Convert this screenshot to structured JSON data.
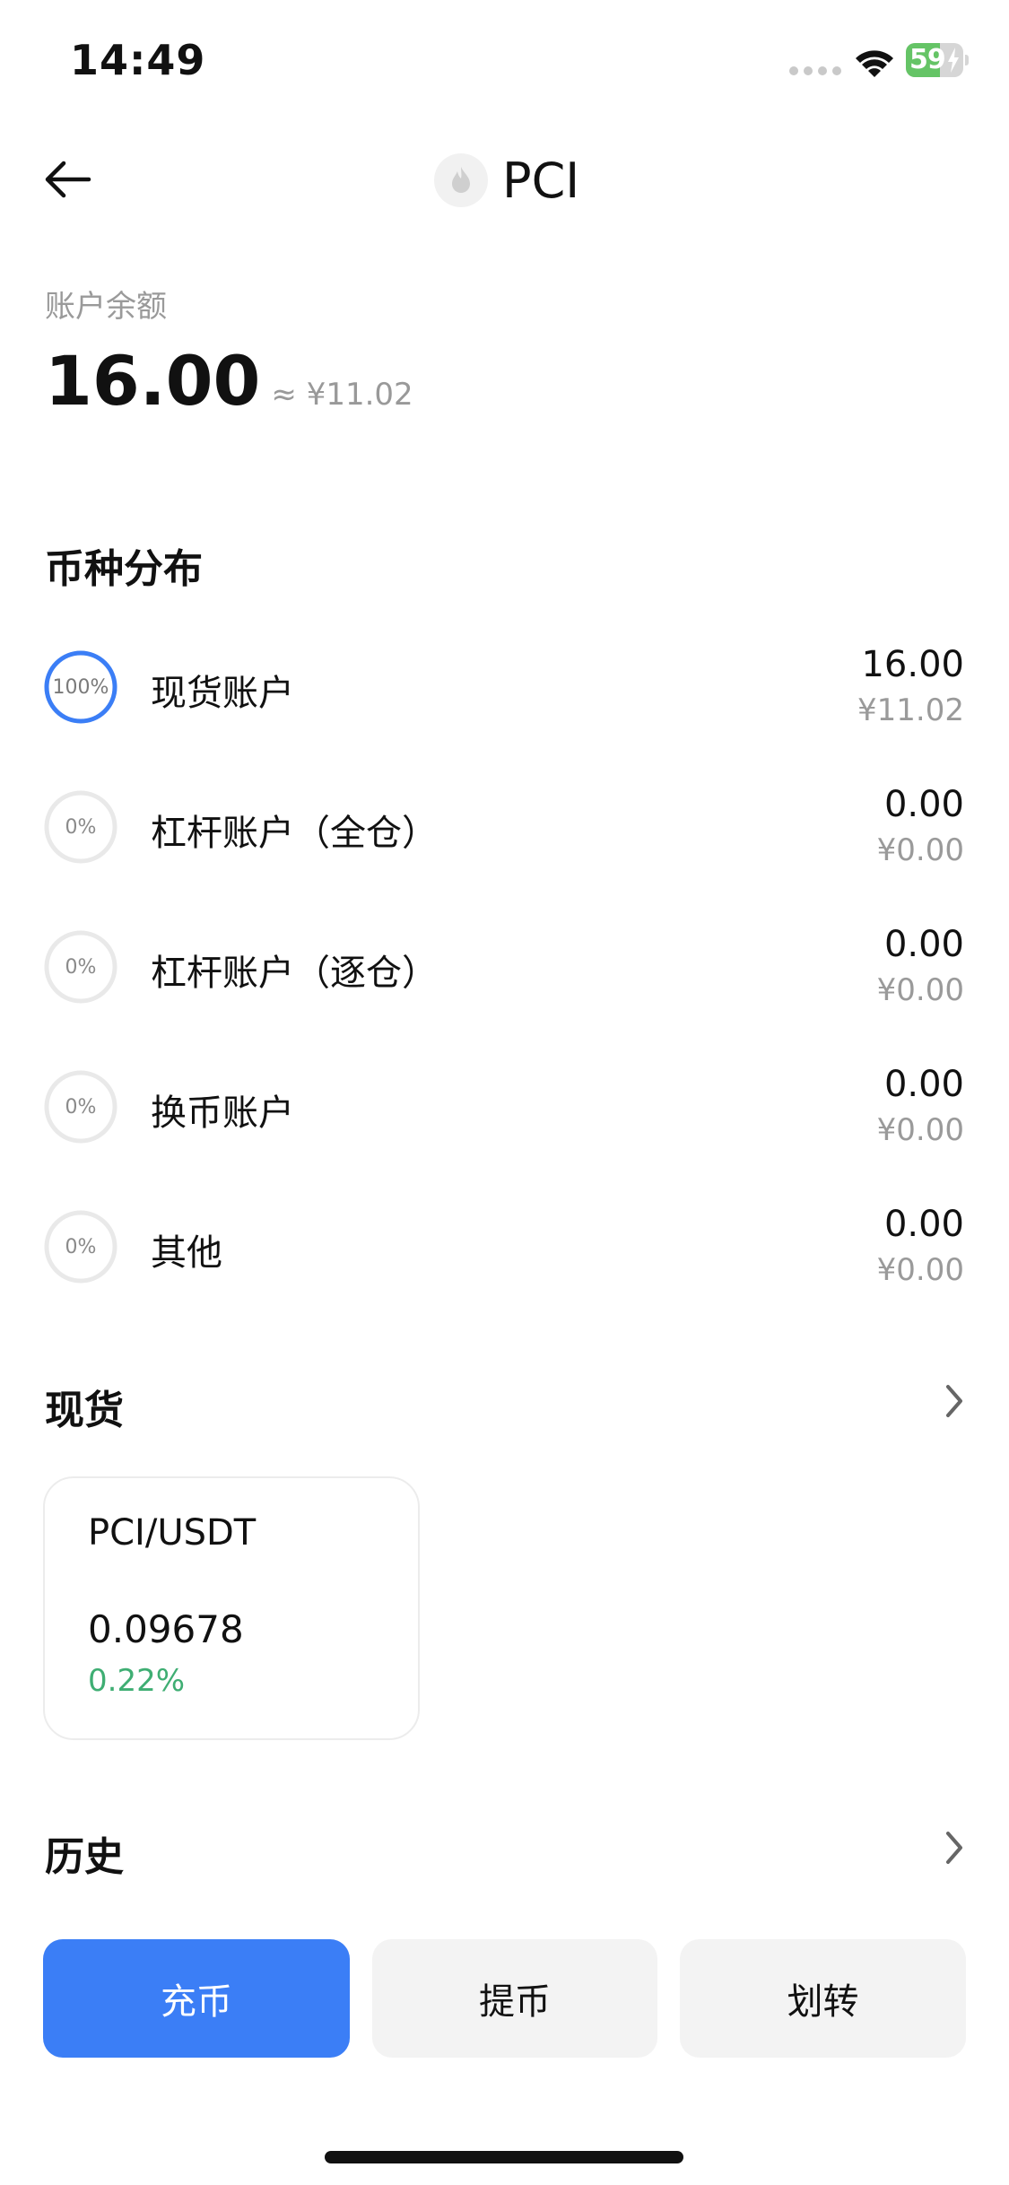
{
  "status_bar": {
    "time": "14:49",
    "battery_level": "59",
    "battery_fraction": 0.59,
    "signal_icon": "signal-dots-icon",
    "wifi_icon": "wifi-icon",
    "battery_icon": "battery-charging-icon"
  },
  "header": {
    "back_icon": "arrow-left-icon",
    "coin_icon": "coin-logo-icon",
    "title": "PCI"
  },
  "balance": {
    "label": "账户余额",
    "value": "16.00",
    "approx": "≈ ¥11.02"
  },
  "distribution": {
    "title": "币种分布",
    "items": [
      {
        "percent_label": "100%",
        "percent": 100,
        "name": "现货账户",
        "amount": "16.00",
        "cny": "¥11.02"
      },
      {
        "percent_label": "0%",
        "percent": 0,
        "name": "杠杆账户（全仓）",
        "amount": "0.00",
        "cny": "¥0.00"
      },
      {
        "percent_label": "0%",
        "percent": 0,
        "name": "杠杆账户（逐仓）",
        "amount": "0.00",
        "cny": "¥0.00"
      },
      {
        "percent_label": "0%",
        "percent": 0,
        "name": "换币账户",
        "amount": "0.00",
        "cny": "¥0.00"
      },
      {
        "percent_label": "0%",
        "percent": 0,
        "name": "其他",
        "amount": "0.00",
        "cny": "¥0.00"
      }
    ]
  },
  "spot": {
    "title": "现货",
    "chevron_icon": "chevron-right-icon",
    "card": {
      "pair": "PCI/USDT",
      "price": "0.09678",
      "change": "0.22%"
    }
  },
  "history": {
    "title": "历史",
    "chevron_icon": "chevron-right-icon"
  },
  "actions": {
    "deposit": "充币",
    "withdraw": "提币",
    "transfer": "划转"
  },
  "colors": {
    "accent": "#3b7ef6",
    "positive": "#3fae73",
    "battery": "#65c466",
    "muted_text": "#9a9a9a",
    "ring_track": "#e9e9e9"
  }
}
